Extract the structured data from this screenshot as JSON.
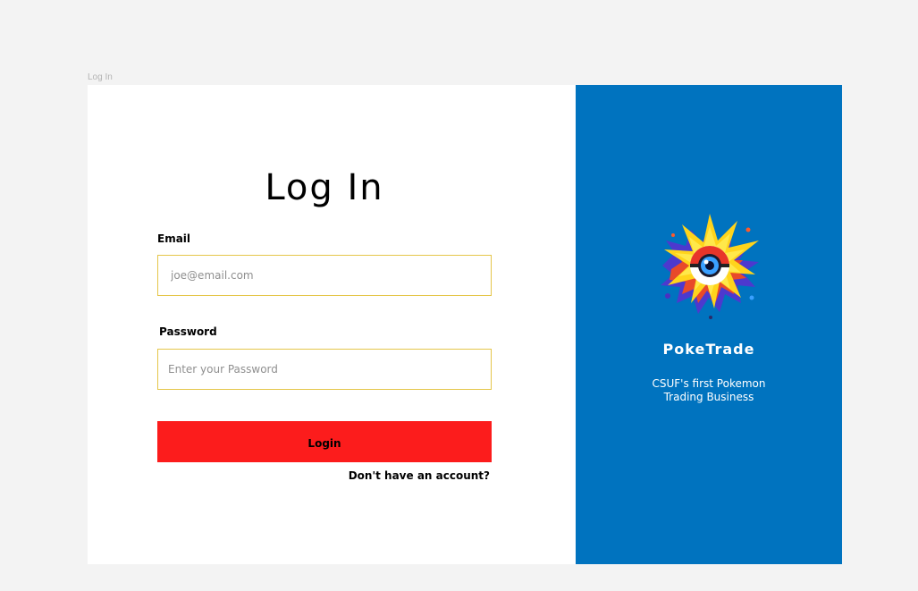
{
  "page": {
    "frame_label": "Log In"
  },
  "form": {
    "title": "Log In",
    "email_label": "Email",
    "email_placeholder": "joe@email.com",
    "password_label": "Password",
    "password_placeholder": "Enter your Password",
    "login_label": "Login",
    "signup_link": "Don't have an account?"
  },
  "brand": {
    "name": "PokeTrade",
    "tagline": "CSUF's first Pokemon Trading Business",
    "logo_icon": "poketrade-logo-icon"
  },
  "colors": {
    "panel": "#0073bf",
    "button": "#fc1c1c",
    "field_border": "#e5c64a",
    "background": "#f3f3f3"
  }
}
